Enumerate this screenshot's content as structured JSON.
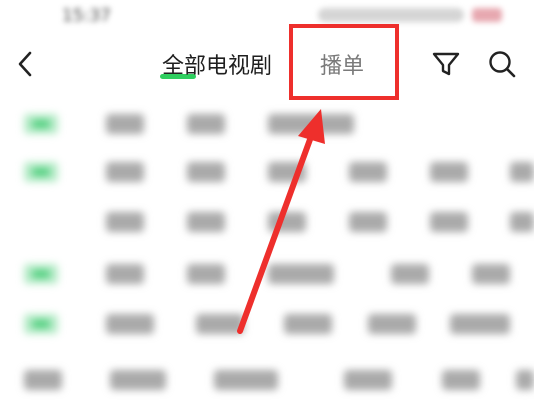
{
  "header": {
    "tabs": [
      {
        "label": "全部电视剧",
        "active": true
      },
      {
        "label": "播单",
        "active": false
      }
    ]
  },
  "icons": {
    "back": "chevron-left-icon",
    "filter": "filter-funnel-icon",
    "search": "search-icon"
  },
  "colors": {
    "accent": "#2ecf5f",
    "annotation": "#ee2f2c",
    "chip_active_bg": "#b6ebc8"
  }
}
